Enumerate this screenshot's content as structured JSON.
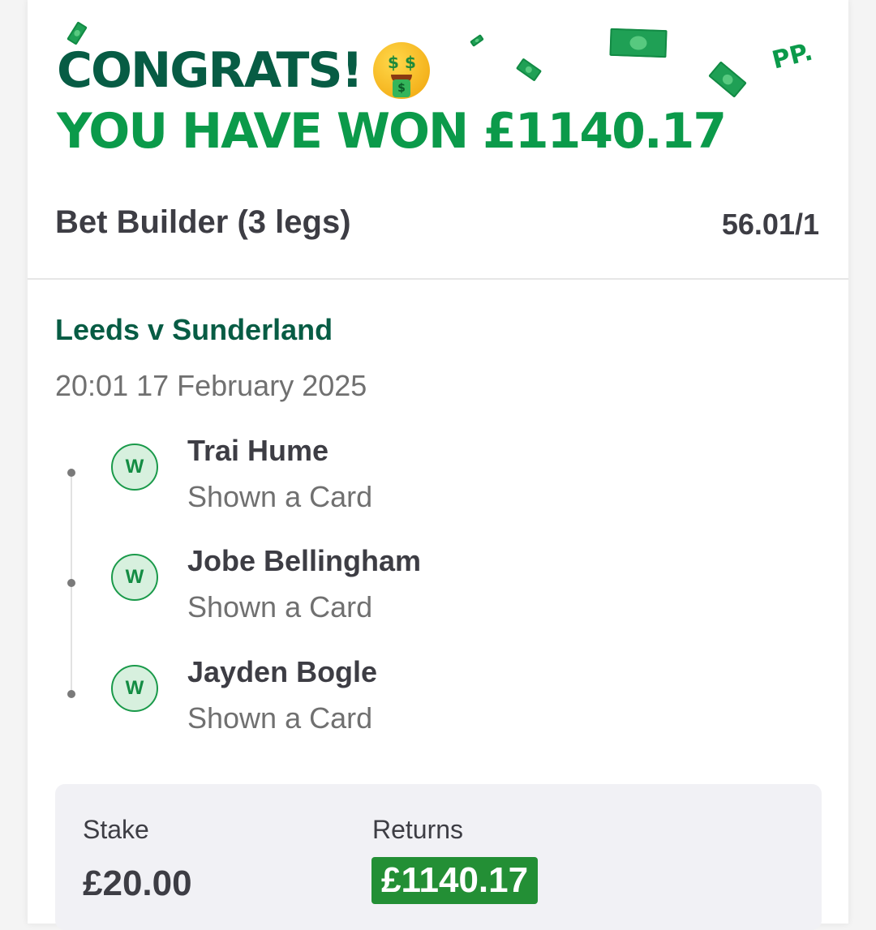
{
  "header": {
    "congrats": "CONGRATS!",
    "won_text": "YOU HAVE WON £1140.17",
    "brand_mark": "PP."
  },
  "bet": {
    "title": "Bet Builder (3 legs)",
    "odds": "56.01/1"
  },
  "event": {
    "name": "Leeds v Sunderland",
    "datetime": "20:01 17 February 2025"
  },
  "legs": [
    {
      "result": "W",
      "selection": "Trai Hume",
      "market": "Shown a Card"
    },
    {
      "result": "W",
      "selection": "Jobe Bellingham",
      "market": "Shown a Card"
    },
    {
      "result": "W",
      "selection": "Jayden Bogle",
      "market": "Shown a Card"
    }
  ],
  "summary": {
    "stake_label": "Stake",
    "stake_value": "£20.00",
    "returns_label": "Returns",
    "returns_value": "£1140.17"
  },
  "colors": {
    "dark_green": "#075c44",
    "bright_green": "#0b9a4a",
    "returns_badge": "#238f35",
    "win_badge_bg": "#d7f0de"
  },
  "icons": {
    "emoji": "money-mouth-face-icon",
    "bills": "money-bill-icon"
  }
}
